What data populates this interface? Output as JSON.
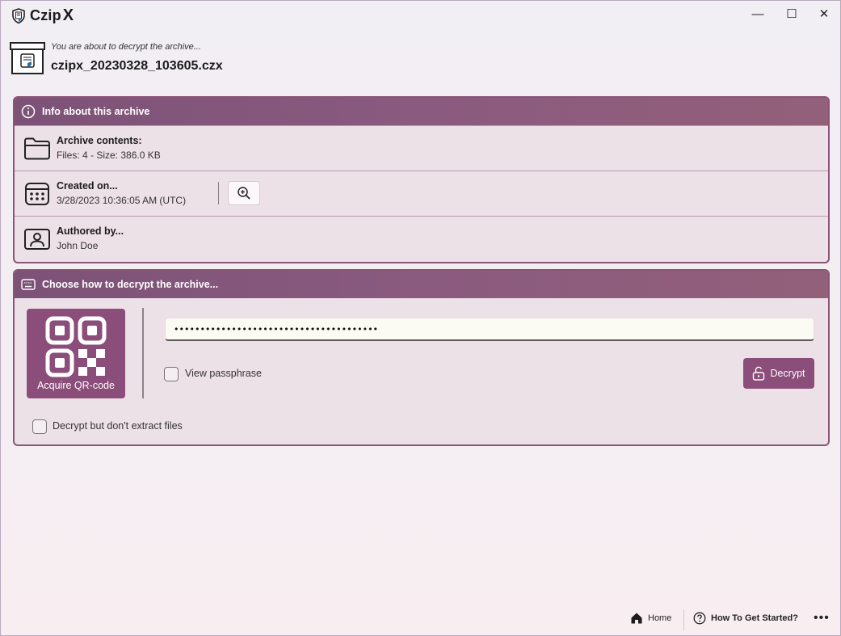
{
  "app": {
    "title": "Czip",
    "title_suffix": "X"
  },
  "window_controls": {
    "minimize": "—",
    "maximize": "☐",
    "close": "✕"
  },
  "archive": {
    "subtitle": "You are about to decrypt the archive...",
    "filename": "czipx_20230328_103605.czx"
  },
  "info_card": {
    "header": "Info about this archive",
    "rows": [
      {
        "title": "Archive contents:",
        "value": "Files: 4 - Size: 386.0 KB",
        "icon": "folder-icon"
      },
      {
        "title": "Created on...",
        "value": "3/28/2023 10:36:05 AM (UTC)",
        "icon": "calendar-icon"
      },
      {
        "title": "Authored by...",
        "value": "John Doe",
        "icon": "contact-card-icon"
      }
    ]
  },
  "decrypt_card": {
    "header": "Choose how to decrypt the archive...",
    "qr_button_label": "Acquire QR-code",
    "passphrase_value": "•••••••••••••••••••••••••••••••••••••••",
    "view_passphrase_label": "View passphrase",
    "decrypt_button_label": "Decrypt",
    "no_extract_label": "Decrypt but don't extract files"
  },
  "footer": {
    "home_label": "Home",
    "help_label": "How To Get Started?",
    "more_label": "•••"
  },
  "colors": {
    "accent": "#8b4d79",
    "header_gradient_start": "#7d5277",
    "card_background": "#ede1e8"
  }
}
